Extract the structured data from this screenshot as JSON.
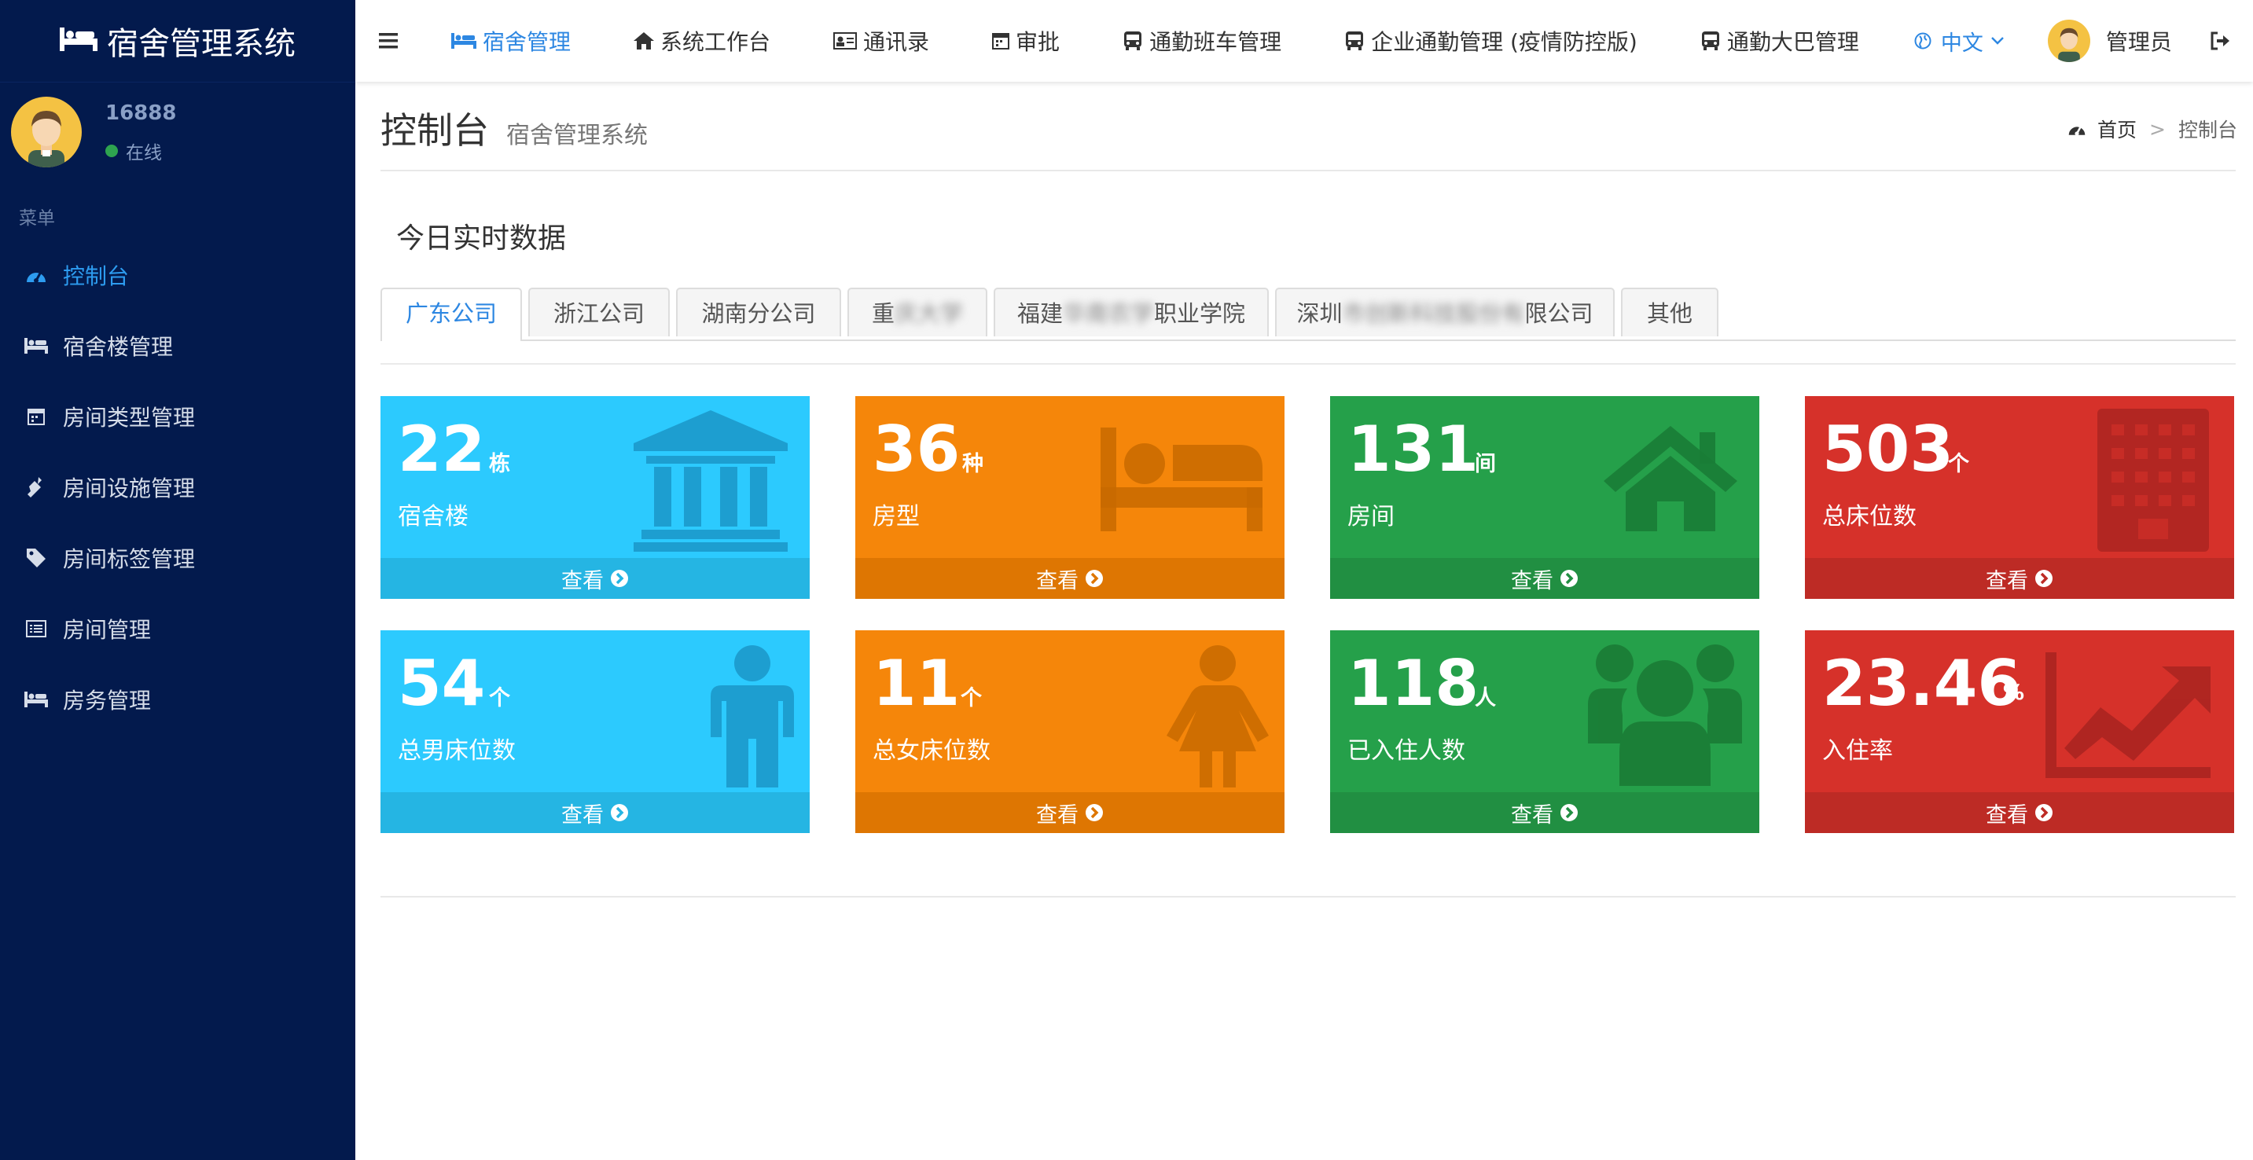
{
  "app": {
    "title": "宿舍管理系统"
  },
  "colors": {
    "sidebar_bg": "#031a4d",
    "accent": "#2d87e2",
    "aqua": "#2ccafe",
    "orange": "#f5860a",
    "green": "#25a04a",
    "red": "#d6312a"
  },
  "user": {
    "name": "16888",
    "status": "在线"
  },
  "sidebar": {
    "menu_header": "菜单",
    "items": [
      {
        "label": "控制台",
        "icon": "dashboard-icon",
        "active": true
      },
      {
        "label": "宿舍楼管理",
        "icon": "bed-icon"
      },
      {
        "label": "房间类型管理",
        "icon": "calendar-icon"
      },
      {
        "label": "房间设施管理",
        "icon": "plug-icon"
      },
      {
        "label": "房间标签管理",
        "icon": "tag-icon"
      },
      {
        "label": "房间管理",
        "icon": "list-alt-icon"
      },
      {
        "label": "房务管理",
        "icon": "bed-icon"
      }
    ]
  },
  "navbar": {
    "items": [
      {
        "label": "宿舍管理",
        "icon": "bed-icon",
        "active": true
      },
      {
        "label": "系统工作台",
        "icon": "home-icon"
      },
      {
        "label": "通讯录",
        "icon": "address-card-icon"
      },
      {
        "label": "审批",
        "icon": "calendar-icon"
      },
      {
        "label": "通勤班车管理",
        "icon": "bus-icon"
      },
      {
        "label": "企业通勤管理 (疫情防控版)",
        "icon": "bus-icon"
      },
      {
        "label": "通勤大巴管理",
        "icon": "bus-icon"
      }
    ],
    "language": "中文",
    "user_label": "管理员"
  },
  "header": {
    "title": "控制台",
    "subtitle": "宿舍管理系统"
  },
  "breadcrumb": {
    "home": "首页",
    "sep": ">",
    "current": "控制台"
  },
  "section_title": "今日实时数据",
  "tabs": [
    {
      "label": "广东公司",
      "active": true
    },
    {
      "label": "浙江公司"
    },
    {
      "label": "湖南分公司"
    },
    {
      "pre": "重",
      "blur": "庆大学"
    },
    {
      "pre": "福建",
      "blur": "华南农学",
      "post": "职业学院"
    },
    {
      "pre": "深圳",
      "blur": "市创新科技股份有",
      "post": "限公司"
    },
    {
      "label": "其他"
    }
  ],
  "cards": [
    {
      "value": "22",
      "unit": "栋",
      "label": "宿舍楼",
      "footer": "查看",
      "color": "aqua",
      "icon": "bank-icon"
    },
    {
      "value": "36",
      "unit": "种",
      "label": "房型",
      "footer": "查看",
      "color": "orange",
      "icon": "bed-icon"
    },
    {
      "value": "131",
      "unit": "间",
      "label": "房间",
      "footer": "查看",
      "color": "green",
      "icon": "home-icon"
    },
    {
      "value": "503",
      "unit": "个",
      "label": "总床位数",
      "footer": "查看",
      "color": "red",
      "icon": "building-icon"
    },
    {
      "value": "54",
      "unit": "个",
      "label": "总男床位数",
      "footer": "查看",
      "color": "aqua",
      "icon": "male-icon"
    },
    {
      "value": "11",
      "unit": "个",
      "label": "总女床位数",
      "footer": "查看",
      "color": "orange",
      "icon": "female-icon"
    },
    {
      "value": "118",
      "unit": "人",
      "label": "已入住人数",
      "footer": "查看",
      "color": "green",
      "icon": "users-icon"
    },
    {
      "value": "23.46",
      "unit": "%",
      "label": "入住率",
      "footer": "查看",
      "color": "red",
      "icon": "line-chart-icon"
    }
  ]
}
